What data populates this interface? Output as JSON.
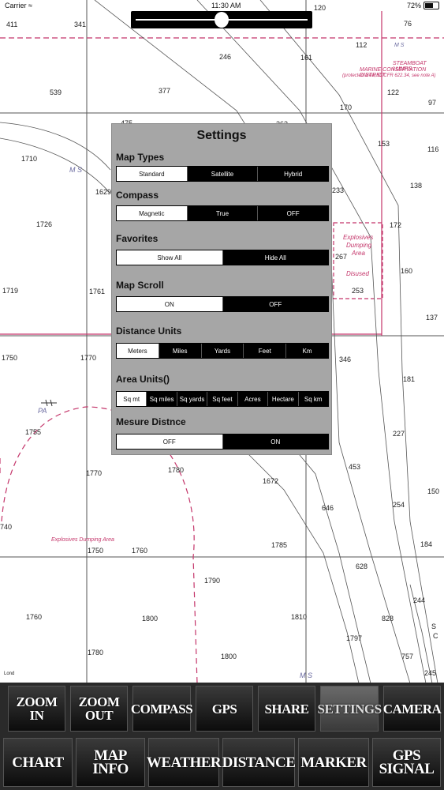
{
  "status_bar": {
    "carrier": "Carrier",
    "time": "11:30 AM",
    "battery": "72%",
    "battery_level": 0.72
  },
  "zoom_slider": {
    "value": 0.5
  },
  "chart": {
    "depths": [
      "411",
      "341",
      "120",
      "76",
      "246",
      "161",
      "112",
      "539",
      "377",
      "122",
      "97",
      "170",
      "475",
      "263",
      "153",
      "116",
      "1710",
      "1629",
      "233",
      "138",
      "1726",
      "172",
      "267",
      "160",
      "1719",
      "1761",
      "253",
      "137",
      "1750",
      "1770",
      "346",
      "181",
      "1755",
      "227",
      "1780",
      "453",
      "1770",
      "1672",
      "150",
      "254",
      "646",
      "740",
      "1750",
      "1760",
      "1785",
      "184",
      "628",
      "1790",
      "244",
      "1760",
      "1800",
      "1810",
      "828",
      "1797",
      "1780",
      "1800",
      "757",
      "245"
    ],
    "labels": {
      "ms_1": "M S",
      "ms_2": "M S",
      "ms_3": "M S",
      "steamboat": "STEAMBOAT LUMPS",
      "marine": "MARINE CONSERVATION DISTRICT",
      "protected": "(protected area; 50 CFR 622.34, see note A)",
      "expl_1": "Explosives",
      "expl_2": "Dumping",
      "expl_3": "Area",
      "disused": "Disused",
      "pa": "PA",
      "expl_area": "Explosives Dumping Area",
      "s_c": "S",
      "s_c2": "C",
      "lond": "Lond"
    }
  },
  "settings": {
    "title": "Settings",
    "sections": [
      {
        "label": "Map Types",
        "options": [
          "Standard",
          "Satellite",
          "Hybrid"
        ],
        "selected": 0
      },
      {
        "label": "Compass",
        "options": [
          "Magnetic",
          "True",
          "OFF"
        ],
        "selected": 0
      },
      {
        "label": "Favorites",
        "options": [
          "Show All",
          "Hide All"
        ],
        "selected": 0
      },
      {
        "label": "Map Scroll",
        "options": [
          "ON",
          "OFF"
        ],
        "selected": 0
      },
      {
        "label": "Distance Units",
        "options": [
          "Meters",
          "Miles",
          "Yards",
          "Feet",
          "Km"
        ],
        "selected": 0
      },
      {
        "label": "Area Units()",
        "options": [
          "Sq mt",
          "Sq miles",
          "Sq yards",
          "Sq feet",
          "Acres",
          "Hectare",
          "Sq km"
        ],
        "selected": 0
      },
      {
        "label": "Mesure Distnce",
        "options": [
          "OFF",
          "ON"
        ],
        "selected": 0
      }
    ]
  },
  "toolbar": {
    "row1": [
      "ZOOM IN",
      "ZOOM OUT",
      "COMPASS",
      "GPS",
      "SHARE",
      "SETTINGS",
      "CAMERA"
    ],
    "row2": [
      "CHART",
      "MAP INFO",
      "WEATHER",
      "DISTANCE",
      "MARKER",
      "GPS SIGNAL"
    ],
    "active": "SETTINGS"
  },
  "colors": {
    "chart_magenta": "#c4356a",
    "panel_gray": "#a6a6a6",
    "button_black": "#000000"
  }
}
